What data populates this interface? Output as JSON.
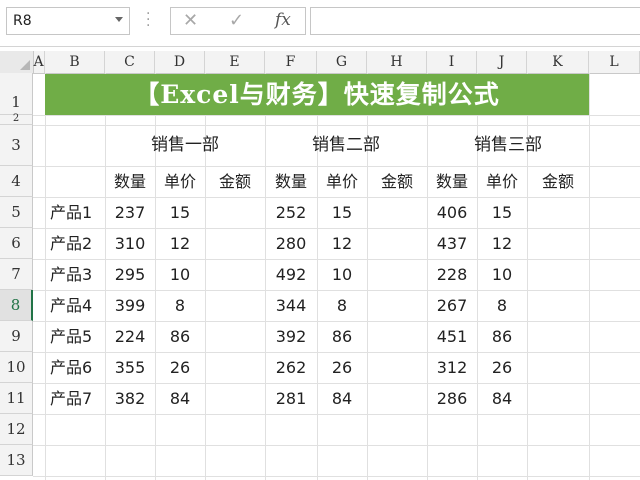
{
  "name_box": "R8",
  "formula_buttons": {
    "cancel": "✕",
    "enter": "✓",
    "fx": "fx"
  },
  "columns": [
    "A",
    "B",
    "C",
    "D",
    "E",
    "F",
    "G",
    "H",
    "I",
    "J",
    "K",
    "L"
  ],
  "rows": [
    "1",
    "2",
    "3",
    "4",
    "5",
    "6",
    "7",
    "8",
    "9",
    "10",
    "11",
    "12",
    "13"
  ],
  "active_row": "8",
  "title": "【Excel与财务】快速复制公式",
  "departments": [
    "销售一部",
    "销售二部",
    "销售三部"
  ],
  "sub_headers": [
    "数量",
    "单价",
    "金额"
  ],
  "products": [
    {
      "name": "产品1",
      "d1": [
        "237",
        "15"
      ],
      "d2": [
        "252",
        "15"
      ],
      "d3": [
        "406",
        "15"
      ]
    },
    {
      "name": "产品2",
      "d1": [
        "310",
        "12"
      ],
      "d2": [
        "280",
        "12"
      ],
      "d3": [
        "437",
        "12"
      ]
    },
    {
      "name": "产品3",
      "d1": [
        "295",
        "10"
      ],
      "d2": [
        "492",
        "10"
      ],
      "d3": [
        "228",
        "10"
      ]
    },
    {
      "name": "产品4",
      "d1": [
        "399",
        "8"
      ],
      "d2": [
        "344",
        "8"
      ],
      "d3": [
        "267",
        "8"
      ]
    },
    {
      "name": "产品5",
      "d1": [
        "224",
        "86"
      ],
      "d2": [
        "392",
        "86"
      ],
      "d3": [
        "451",
        "86"
      ]
    },
    {
      "name": "产品6",
      "d1": [
        "355",
        "26"
      ],
      "d2": [
        "262",
        "26"
      ],
      "d3": [
        "312",
        "26"
      ]
    },
    {
      "name": "产品7",
      "d1": [
        "382",
        "84"
      ],
      "d2": [
        "281",
        "84"
      ],
      "d3": [
        "286",
        "84"
      ]
    }
  ]
}
